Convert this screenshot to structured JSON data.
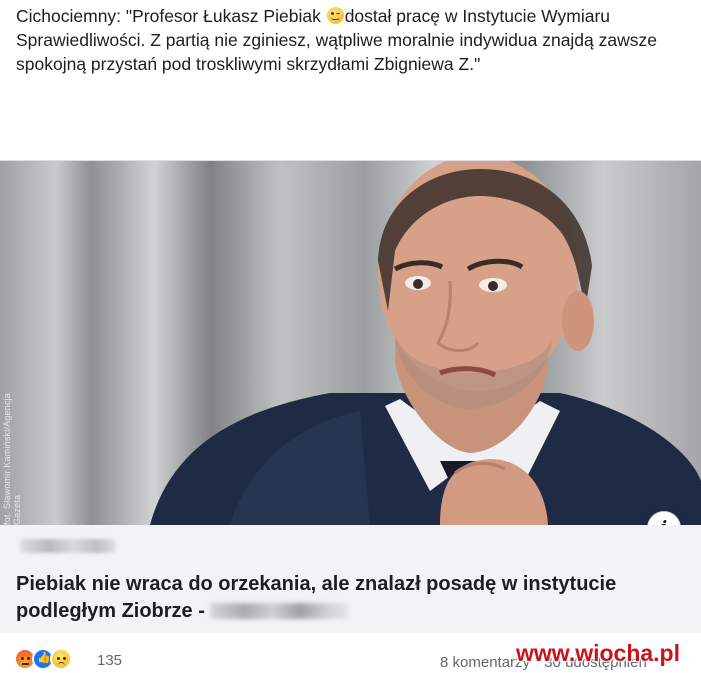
{
  "post": {
    "text_before_emoji": "Cichociemny: \"Profesor Łukasz Piebiak ",
    "emoji": "wink-emoji",
    "text_after_emoji": "dostał pracę w Instytucie Wymiaru Sprawiedliwości. Z partią nie zginiesz, wątpliwe moralnie indywidua znajdą zawsze spokojną przystań pod troskliwymi skrzydłami Zbigniewa Z.\""
  },
  "link_card": {
    "photo_credit": "fot. Sławomir Kamiński/Agencja Gazeta",
    "info_label": "i",
    "headline": "Piebiak nie wraca do orzekania, ale znalazł posadę w instytucie podległym Ziobrze - "
  },
  "footer": {
    "reactions": [
      "angry",
      "like",
      "sad"
    ],
    "reaction_count": "135",
    "comments": "8 komentarzy",
    "shares": "30 udostępnień"
  },
  "watermark": "www.wiocha.pl",
  "colors": {
    "text": "#1c1e21",
    "card_bg": "#f2f3f5",
    "meta_text": "#606770",
    "like_blue": "#1877f2",
    "watermark_red": "#c9141b"
  }
}
